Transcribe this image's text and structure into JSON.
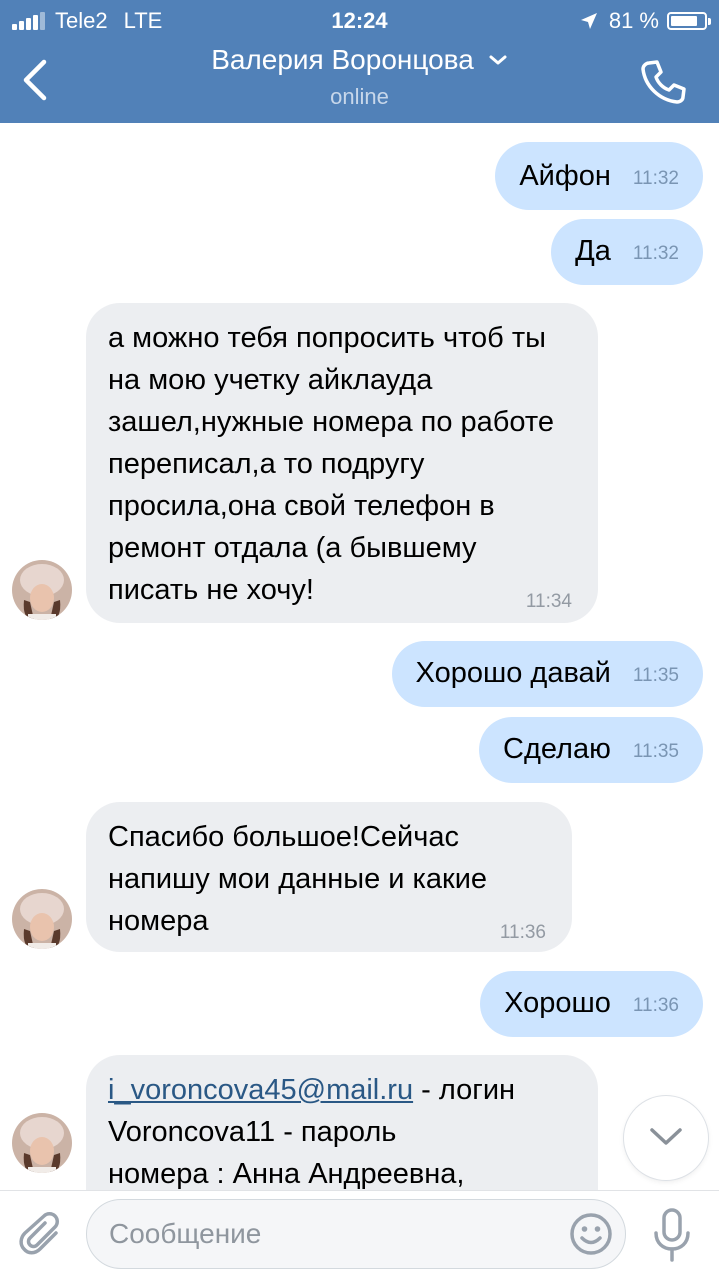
{
  "status_bar": {
    "carrier": "Tele2",
    "network": "LTE",
    "time": "12:24",
    "battery": "81 %",
    "battery_level": 0.81
  },
  "header": {
    "contact_name": "Валерия Воронцова",
    "status": "online",
    "background_color": "#5181b8"
  },
  "messages": [
    {
      "direction": "out",
      "text": "Айфон",
      "time": "11:32"
    },
    {
      "direction": "out",
      "text": "Да",
      "time": "11:32"
    },
    {
      "direction": "in",
      "text": "а можно тебя попросить чтоб ты на мою учетку айклауда зашел,нужные номера по работе переписал,а то подругу просила,она свой телефон в ремонт отдала (а бывшему писать не хочу!",
      "time": "11:34"
    },
    {
      "direction": "out",
      "text": "Хорошо давай",
      "time": "11:35"
    },
    {
      "direction": "out",
      "text": "Сделаю",
      "time": "11:35"
    },
    {
      "direction": "in",
      "text": "Спасибо большое!Сейчас напишу мои данные и какие номера",
      "time": "11:36"
    },
    {
      "direction": "out",
      "text": "Хорошо",
      "time": "11:36"
    },
    {
      "direction": "in",
      "link": "i_voroncova45@mail.ru",
      "text_after_link": " - логин",
      "line2": "Voroncova11 - пароль",
      "line3": "номера : Анна Андреевна,"
    }
  ],
  "composer": {
    "placeholder": "Сообщение"
  },
  "icons": {
    "back": "chevron-left-icon",
    "title_dropdown": "chevron-down-icon",
    "call": "phone-icon",
    "scroll": "chevron-down-icon",
    "attach": "paperclip-icon",
    "emoji": "smiley-icon",
    "mic": "microphone-icon"
  },
  "colors": {
    "outgoing_bubble": "#cce4ff",
    "incoming_bubble": "#eceef1",
    "link": "#2a5885"
  }
}
